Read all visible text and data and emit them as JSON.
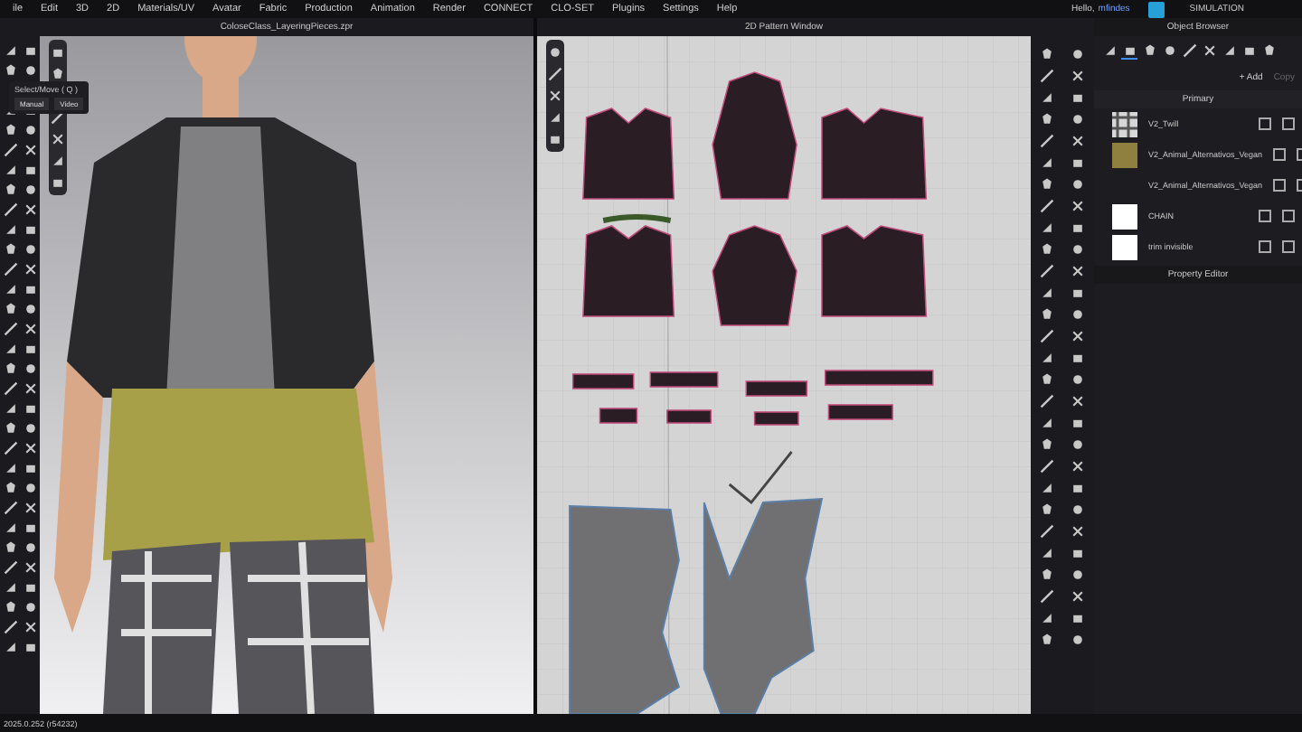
{
  "menu": [
    "ile",
    "Edit",
    "3D",
    "2D",
    "Materials/UV",
    "Avatar",
    "Fabric",
    "Production",
    "Animation",
    "Render",
    "CONNECT",
    "CLO-SET",
    "Plugins",
    "Settings",
    "Help"
  ],
  "account": {
    "greeting": "Hello,",
    "user": "mfindes"
  },
  "mode": "SIMULATION",
  "viewport_3d": {
    "title": "ColoseClass_LayeringPieces.zpr",
    "tooltip": {
      "title": "Select/Move ( Q )",
      "buttons": [
        "Manual",
        "Video"
      ]
    }
  },
  "pattern_window": {
    "title": "2D Pattern Window"
  },
  "object_browser": {
    "title": "Object Browser",
    "tabs": [
      {
        "selected": false
      },
      {
        "selected": true
      },
      {
        "selected": false
      },
      {
        "selected": false
      },
      {
        "selected": false
      },
      {
        "selected": false
      },
      {
        "selected": false
      },
      {
        "selected": false
      },
      {
        "selected": false
      }
    ],
    "actions": [
      {
        "label": "+ Add",
        "disabled": false
      },
      {
        "label": "Copy",
        "disabled": true
      }
    ],
    "group": "Primary",
    "items": [
      {
        "name": "V2_Twill",
        "kind": "plaid"
      },
      {
        "name": "V2_Animal_Alternativos_Vegan",
        "kind": "solid",
        "color": "#8f8040"
      },
      {
        "name": "V2_Animal_Alternativos_Vegan",
        "kind": "none"
      },
      {
        "name": "CHAIN",
        "kind": "solid",
        "color": "#ffffff"
      },
      {
        "name": "trim invisible",
        "kind": "solid",
        "color": "#ffffff"
      }
    ]
  },
  "property_editor": {
    "title": "Property Editor"
  },
  "status_bar": "2025.0.252 (r54232)"
}
